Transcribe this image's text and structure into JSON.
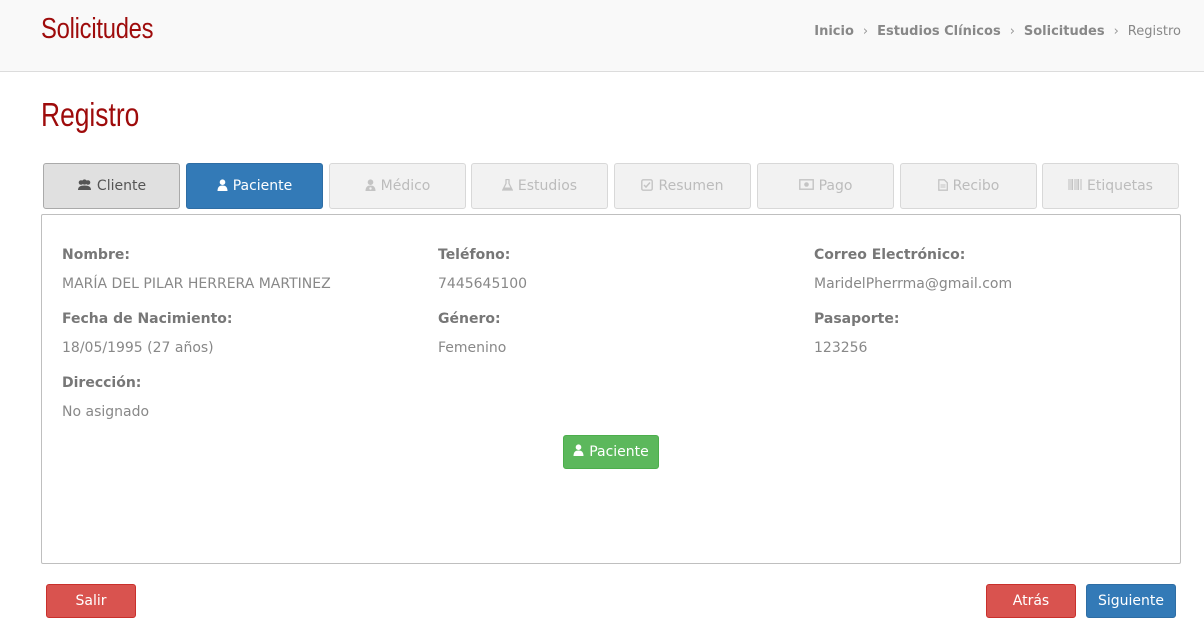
{
  "header": {
    "title": "Solicitudes",
    "breadcrumb": [
      {
        "label": "Inicio"
      },
      {
        "label": "Estudios Clínicos"
      },
      {
        "label": "Solicitudes"
      },
      {
        "label": "Registro"
      }
    ],
    "separator": "›"
  },
  "page_title": "Registro",
  "tabs": [
    {
      "label": "Cliente",
      "icon": "users-icon",
      "state": "done"
    },
    {
      "label": "Paciente",
      "icon": "user-icon",
      "state": "active"
    },
    {
      "label": "Médico",
      "icon": "doctor-icon",
      "state": "disabled"
    },
    {
      "label": "Estudios",
      "icon": "flask-icon",
      "state": "disabled"
    },
    {
      "label": "Resumen",
      "icon": "check-square-icon",
      "state": "disabled"
    },
    {
      "label": "Pago",
      "icon": "money-icon",
      "state": "disabled"
    },
    {
      "label": "Recibo",
      "icon": "file-text-icon",
      "state": "disabled"
    },
    {
      "label": "Etiquetas",
      "icon": "barcode-icon",
      "state": "disabled"
    }
  ],
  "patient": {
    "nombre_label": "Nombre:",
    "nombre": "MARÍA DEL PILAR HERRERA MARTINEZ",
    "telefono_label": "Teléfono:",
    "telefono": "7445645100",
    "correo_label": "Correo Electrónico:",
    "correo": "MaridelPherrma@gmail.com",
    "nacimiento_label": "Fecha de Nacimiento:",
    "nacimiento": "18/05/1995 (27 años)",
    "genero_label": "Género:",
    "genero": "Femenino",
    "pasaporte_label": "Pasaporte:",
    "pasaporte": "123256",
    "direccion_label": "Dirección:",
    "direccion": "No asignado"
  },
  "actions": {
    "paciente_button": "Paciente",
    "salir": "Salir",
    "atras": "Atrás",
    "siguiente": "Siguiente"
  },
  "colors": {
    "brand_red": "#9e0b0b",
    "primary_blue": "#337ab7",
    "success_green": "#5cb85c",
    "danger_red": "#d9534f"
  }
}
